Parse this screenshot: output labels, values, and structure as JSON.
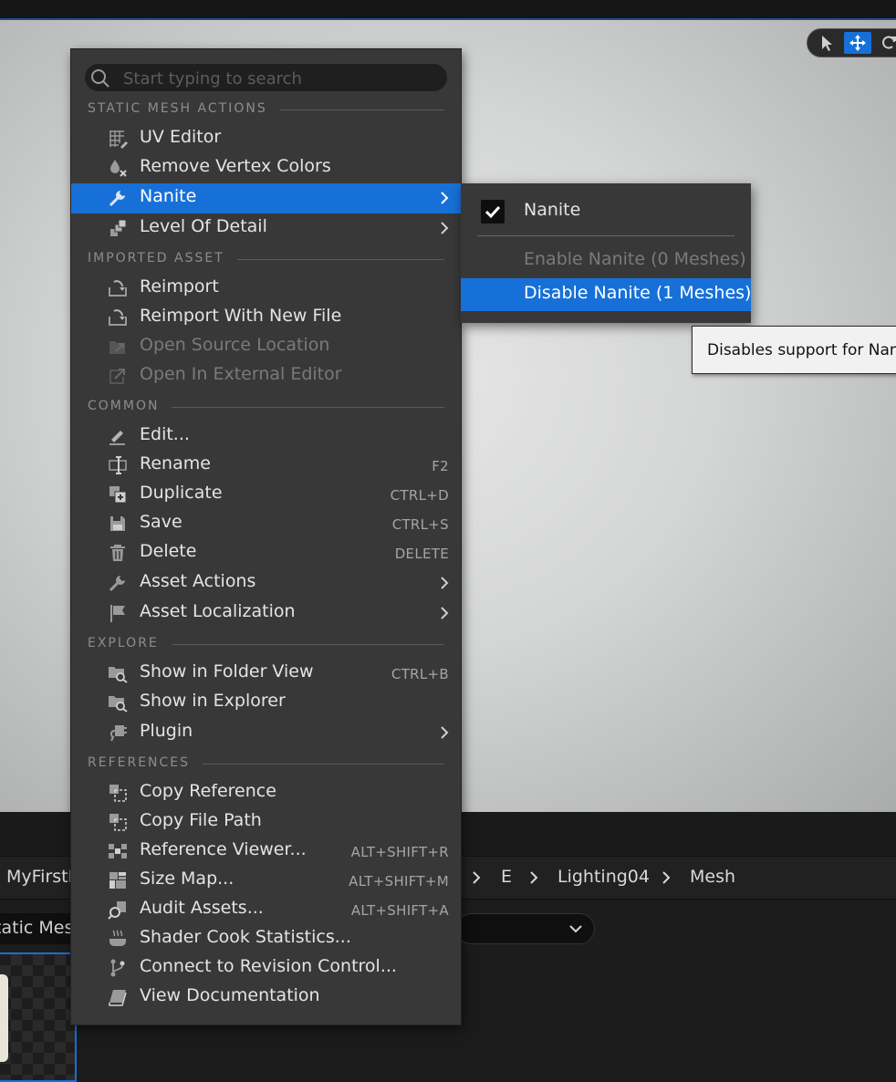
{
  "search": {
    "placeholder": "Start typing to search"
  },
  "sections": {
    "static_mesh_actions": "STATIC MESH ACTIONS",
    "imported_asset": "IMPORTED ASSET",
    "common": "COMMON",
    "explore": "EXPLORE",
    "references": "REFERENCES"
  },
  "items": {
    "uv_editor": "UV Editor",
    "remove_vertex_colors": "Remove Vertex Colors",
    "nanite": "Nanite",
    "level_of_detail": "Level Of Detail",
    "reimport": "Reimport",
    "reimport_new_file": "Reimport With New File",
    "open_source_location": "Open Source Location",
    "open_external_editor": "Open In External Editor",
    "edit": "Edit...",
    "rename": "Rename",
    "duplicate": "Duplicate",
    "save": "Save",
    "delete": "Delete",
    "asset_actions": "Asset Actions",
    "asset_localization": "Asset Localization",
    "show_in_folder_view": "Show in Folder View",
    "show_in_explorer": "Show in Explorer",
    "plugin": "Plugin",
    "copy_reference": "Copy Reference",
    "copy_file_path": "Copy File Path",
    "reference_viewer": "Reference Viewer...",
    "size_map": "Size Map...",
    "audit_assets": "Audit Assets...",
    "shader_cook_statistics": "Shader Cook Statistics...",
    "connect_revision_control": "Connect to Revision Control...",
    "view_documentation": "View Documentation"
  },
  "shortcuts": {
    "rename": "F2",
    "duplicate": "CTRL+D",
    "save": "CTRL+S",
    "delete": "DELETE",
    "show_in_folder_view": "CTRL+B",
    "reference_viewer": "ALT+SHIFT+R",
    "size_map": "ALT+SHIFT+M",
    "audit_assets": "ALT+SHIFT+A"
  },
  "submenu": {
    "title": "Nanite",
    "checked": true,
    "enable": "Enable Nanite (0 Meshes)",
    "disable": "Disable Nanite (1 Meshes)"
  },
  "tooltip": "Disables support for Nanite",
  "breadcrumb": {
    "first": "MyFirstProject",
    "parts": [
      "E",
      "Lighting04",
      "Mesh"
    ]
  },
  "filter": {
    "left": "Static Mesh"
  },
  "colors": {
    "accent": "#1770d8",
    "menu_bg": "#383838"
  }
}
